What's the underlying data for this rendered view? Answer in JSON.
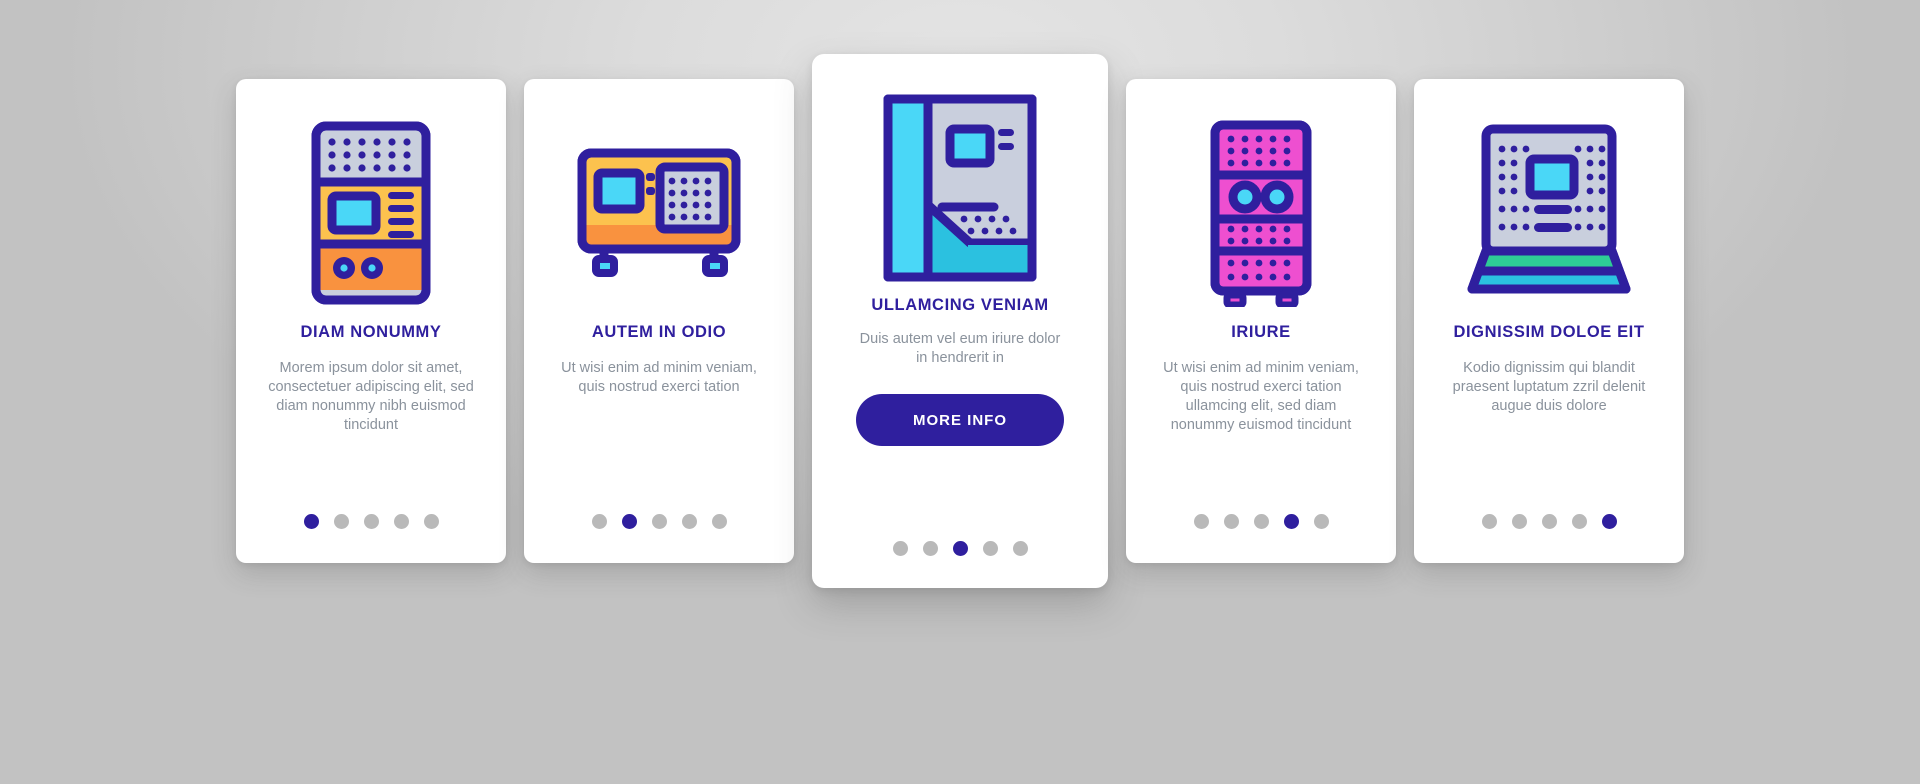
{
  "theme": {
    "accent": "#2f1f9e",
    "title_color": "#2f1f9e",
    "body_color": "#8a929c",
    "dot_inactive": "#b9b9b9",
    "card_bg": "#ffffff",
    "page_bg": "#d4d4d4"
  },
  "cards": [
    {
      "icon": "vending-machine-tall-icon",
      "title": "DIAM NONUMMY",
      "body": "Morem ipsum dolor sit amet, consectetuer adipiscing elit, sed diam nonummy nibh euismod tincidunt",
      "dots": {
        "count": 5,
        "active_index": 0
      },
      "featured": false
    },
    {
      "icon": "counter-top-vending-machine-icon",
      "title": "AUTEM IN ODIO",
      "body": "Ut wisi enim ad minim veniam, quis nostrud exerci tation",
      "dots": {
        "count": 5,
        "active_index": 1
      },
      "featured": false
    },
    {
      "icon": "arcade-cabinet-icon",
      "title": "ULLAMCING VENIAM",
      "body": "Duis autem vel eum iriure dolor in hendrerit in",
      "button_label": "MORE INFO",
      "dots": {
        "count": 5,
        "active_index": 2
      },
      "featured": true
    },
    {
      "icon": "pink-snack-vending-machine-icon",
      "title": "IRIURE",
      "body": "Ut wisi enim ad minim veniam, quis nostrud exerci tation ullamcing elit, sed diam nonummy euismod tincidunt",
      "dots": {
        "count": 5,
        "active_index": 3
      },
      "featured": false
    },
    {
      "icon": "laptop-kiosk-terminal-icon",
      "title": "DIGNISSIM DOLOE EIT",
      "body": "Kodio dignissim qui blandit praesent luptatum zzril delenit augue duis dolore",
      "dots": {
        "count": 5,
        "active_index": 4
      },
      "featured": false
    }
  ]
}
